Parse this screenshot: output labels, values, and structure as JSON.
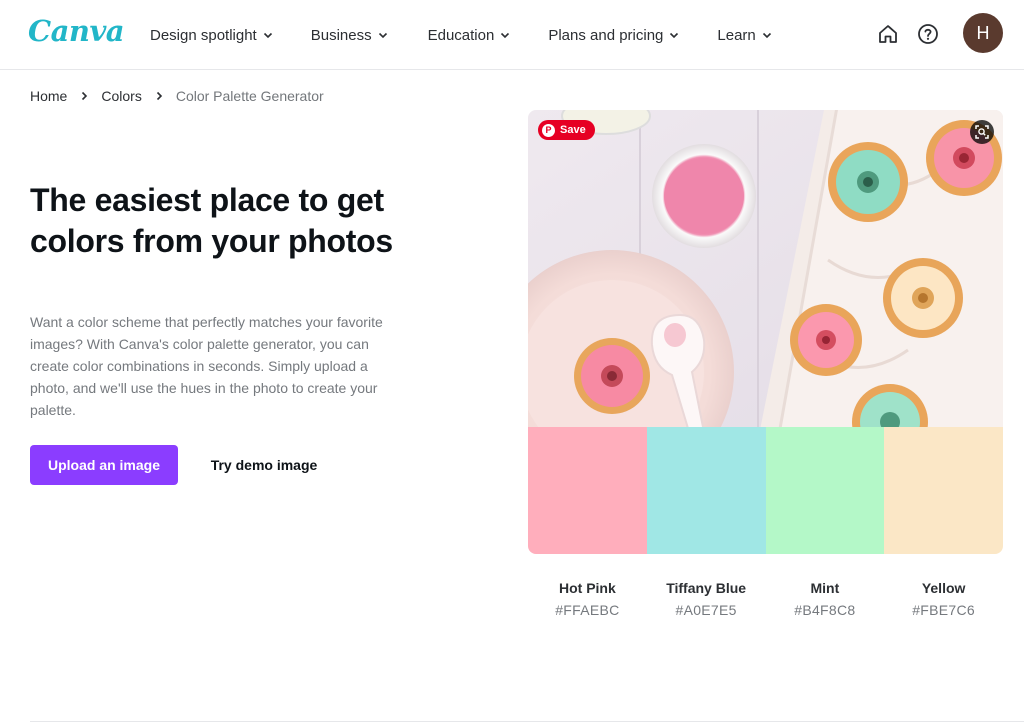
{
  "header": {
    "logo": "Canva",
    "nav": [
      {
        "label": "Design spotlight"
      },
      {
        "label": "Business"
      },
      {
        "label": "Education"
      },
      {
        "label": "Plans and pricing"
      },
      {
        "label": "Learn"
      }
    ],
    "avatar_initial": "H"
  },
  "breadcrumb": {
    "home": "Home",
    "colors": "Colors",
    "current": "Color Palette Generator"
  },
  "hero": {
    "title": "The easiest place to get colors from your photos",
    "description": "Want a color scheme that perfectly matches your favorite images? With Canva's color palette generator, you can create color combinations in seconds. Simply upload a photo, and we'll use the hues in the photo to create your palette.",
    "upload_button": "Upload an image",
    "demo_button": "Try demo image"
  },
  "photo": {
    "save_label": "Save"
  },
  "palette": [
    {
      "name": "Hot Pink",
      "hex": "#FFAEBC"
    },
    {
      "name": "Tiffany Blue",
      "hex": "#A0E7E5"
    },
    {
      "name": "Mint",
      "hex": "#B4F8C8"
    },
    {
      "name": "Yellow",
      "hex": "#FBE7C6"
    }
  ],
  "colors": {
    "brand_purple": "#8B3DFF",
    "logo_teal": "#22B6C8",
    "pinterest_red": "#E60023"
  }
}
